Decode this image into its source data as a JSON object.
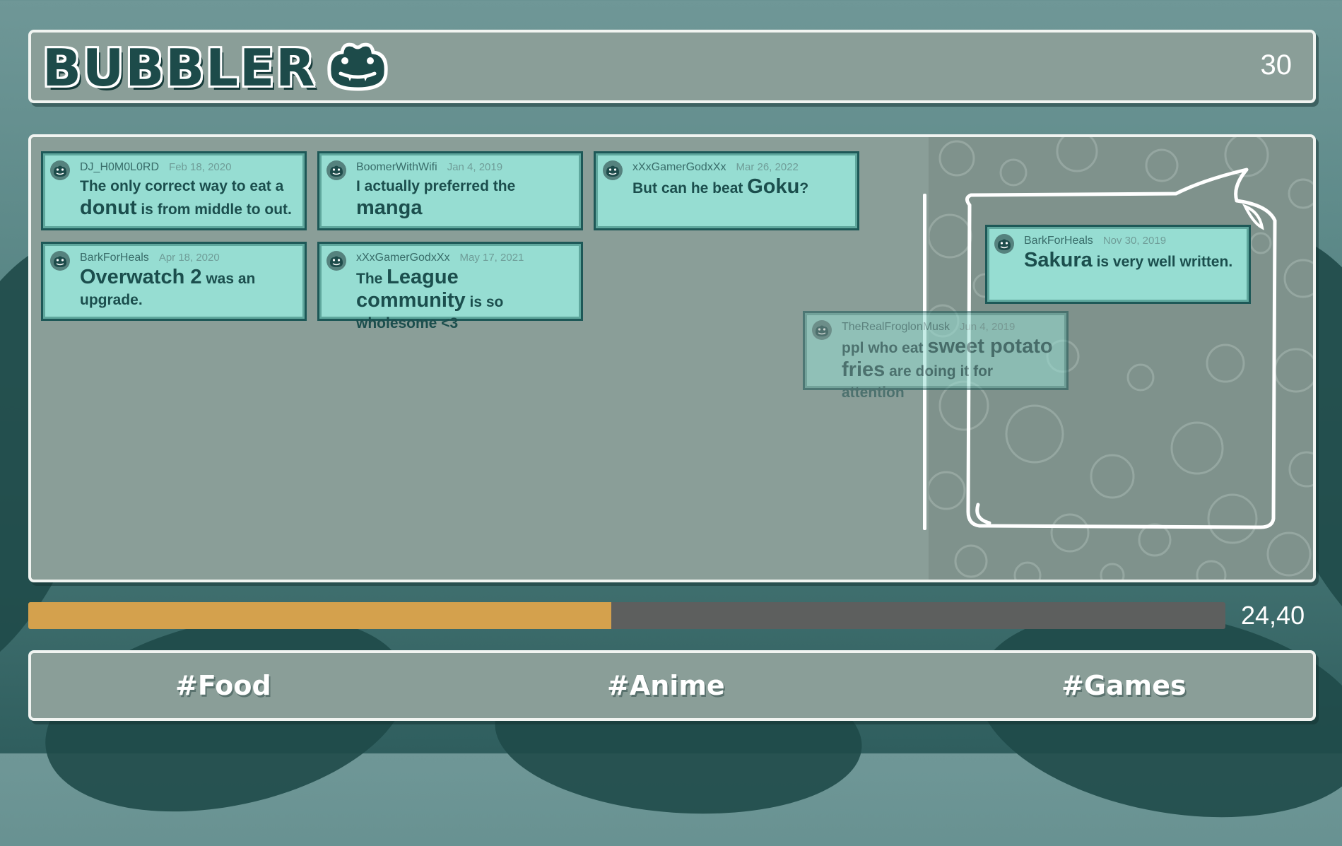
{
  "header": {
    "logo_text": "BUBBLER",
    "logo_icon": "frog-icon",
    "score": "30"
  },
  "posts": [
    {
      "user": "DJ_H0M0L0RD",
      "date": "Feb 18, 2020",
      "parts": [
        [
          "The only correct way to eat a ",
          "n"
        ],
        [
          "donut",
          "b"
        ],
        [
          " is from middle to out.",
          "n"
        ]
      ]
    },
    {
      "user": "BoomerWithWifi",
      "date": "Jan 4, 2019",
      "parts": [
        [
          "I actually preferred the ",
          "n"
        ],
        [
          "manga",
          "b"
        ]
      ]
    },
    {
      "user": "xXxGamerGodxXx",
      "date": "Mar 26, 2022",
      "parts": [
        [
          "But can he beat ",
          "n"
        ],
        [
          "Goku",
          "b"
        ],
        [
          "?",
          "n"
        ]
      ]
    },
    {
      "user": "BarkForHeals",
      "date": "Apr 18, 2020",
      "parts": [
        [
          "Overwatch 2",
          "b"
        ],
        [
          " was an upgrade.",
          "n"
        ]
      ]
    },
    {
      "user": "xXxGamerGodxXx",
      "date": "May 17, 2021",
      "parts": [
        [
          "The ",
          "n"
        ],
        [
          "League community",
          "b"
        ],
        [
          " is so wholesome <3",
          "n"
        ]
      ]
    },
    {
      "user": "TheRealFroglonMusk",
      "date": "Jun 4, 2019",
      "parts": [
        [
          "ppl who eat ",
          "n"
        ],
        [
          "sweet potato fries",
          "b"
        ],
        [
          " are doing it for attention",
          "n"
        ]
      ]
    },
    {
      "user": "BarkForHeals",
      "date": "Nov 30, 2019",
      "parts": [
        [
          "Sakura",
          "b"
        ],
        [
          " is very well written.",
          "n"
        ]
      ]
    }
  ],
  "progress": {
    "fraction": 0.487,
    "value_text": "24,40"
  },
  "tags": [
    "#Food",
    "#Anime",
    "#Games"
  ],
  "colors": {
    "card": "#96ddd2",
    "progress_fill": "#d4a14d",
    "panel": "#8a9e98",
    "ink": "#1b4e4d"
  }
}
